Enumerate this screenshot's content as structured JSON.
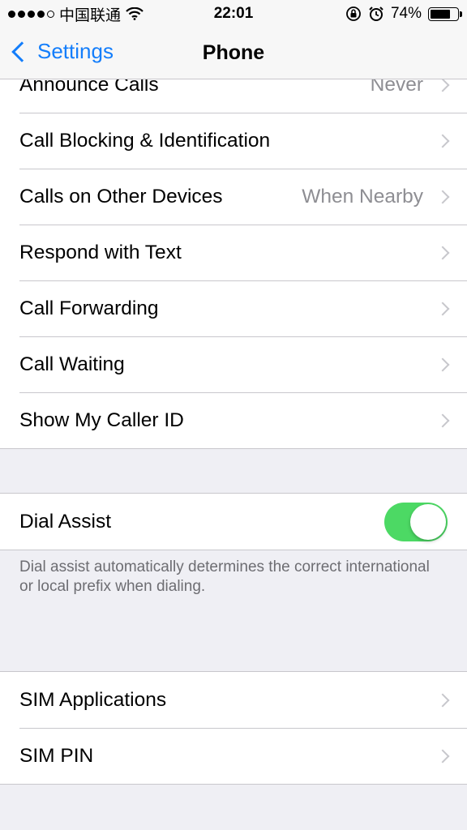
{
  "status_bar": {
    "carrier": "中国联通",
    "time": "22:01",
    "battery_percent": "74%",
    "battery_level": 0.74,
    "signal_bars": 4,
    "icons": [
      "signal-dots-icon",
      "wifi-icon",
      "rotation-lock-icon",
      "alarm-icon",
      "battery-icon"
    ]
  },
  "nav": {
    "back_label": "Settings",
    "title": "Phone"
  },
  "group_calls": {
    "rows": [
      {
        "label": "Announce Calls",
        "value": "Never"
      },
      {
        "label": "Call Blocking & Identification",
        "value": ""
      },
      {
        "label": "Calls on Other Devices",
        "value": "When Nearby"
      },
      {
        "label": "Respond with Text",
        "value": ""
      },
      {
        "label": "Call Forwarding",
        "value": ""
      },
      {
        "label": "Call Waiting",
        "value": ""
      },
      {
        "label": "Show My Caller ID",
        "value": ""
      }
    ]
  },
  "group_dial": {
    "label": "Dial Assist",
    "enabled": true,
    "footnote": "Dial assist automatically determines the correct international or local prefix when dialing."
  },
  "group_sim": {
    "rows": [
      {
        "label": "SIM Applications"
      },
      {
        "label": "SIM PIN"
      }
    ]
  },
  "colors": {
    "accent": "#147efb",
    "toggle_on": "#4cd964",
    "background": "#efeff4",
    "secondary_text": "#8e8e93"
  }
}
